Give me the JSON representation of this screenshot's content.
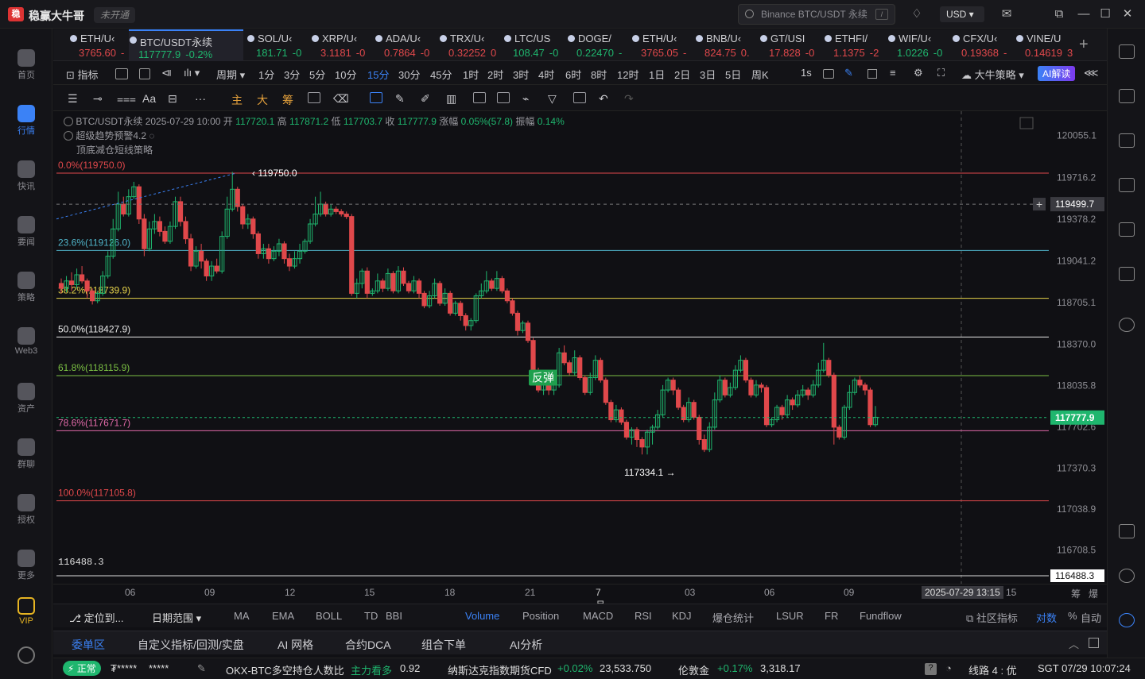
{
  "app": {
    "name": "稳赢大牛哥",
    "account_status": "未开通",
    "logo_char": "稳"
  },
  "search": {
    "placeholder": "Binance BTC/USDT 永续",
    "key": "/"
  },
  "currency": "USD",
  "nav": [
    {
      "label": "首页",
      "icon": "home-icon"
    },
    {
      "label": "行情",
      "icon": "chart-bars-icon",
      "active": true
    },
    {
      "label": "快讯",
      "icon": "news-icon"
    },
    {
      "label": "要闻",
      "icon": "doc-icon"
    },
    {
      "label": "策略",
      "icon": "robot-icon"
    },
    {
      "label": "Web3",
      "icon": "web3-icon"
    },
    {
      "label": "资产",
      "icon": "wallet-icon"
    },
    {
      "label": "群聊",
      "icon": "chat-icon"
    },
    {
      "label": "授权",
      "icon": "key-icon"
    },
    {
      "label": "更多",
      "icon": "grid-icon"
    },
    {
      "label": "VIP",
      "icon": "vip-icon"
    }
  ],
  "symbols": [
    {
      "name": "ETH/U‹",
      "price": "3765.60",
      "chg": "-",
      "color": "#e0484b"
    },
    {
      "name": "BTC/USDT永续",
      "price": "117777.9",
      "chg": "-0.2%",
      "color": "#1fb66e",
      "active": true
    },
    {
      "name": "SOL/U‹",
      "price": "181.71",
      "chg": "-0",
      "color": "#1fb66e"
    },
    {
      "name": "XRP/U‹",
      "price": "3.1181",
      "chg": "-0",
      "color": "#e0484b"
    },
    {
      "name": "ADA/U‹",
      "price": "0.7864",
      "chg": "-0",
      "color": "#e0484b"
    },
    {
      "name": "TRX/U‹",
      "price": "0.32252",
      "chg": "0",
      "color": "#e0484b"
    },
    {
      "name": "LTC/US",
      "price": "108.47",
      "chg": "-0",
      "color": "#1fb66e"
    },
    {
      "name": "DOGE/",
      "price": "0.22470",
      "chg": "-",
      "color": "#1fb66e"
    },
    {
      "name": "ETH/U‹",
      "price": "3765.05",
      "chg": "-",
      "color": "#e0484b"
    },
    {
      "name": "BNB/U‹",
      "price": "824.75",
      "chg": "0.",
      "color": "#e0484b"
    },
    {
      "name": "GT/USI",
      "price": "17.828",
      "chg": "-0",
      "color": "#e0484b"
    },
    {
      "name": "ETHFI/",
      "price": "1.1375",
      "chg": "-2",
      "color": "#e0484b"
    },
    {
      "name": "WIF/U‹",
      "price": "1.0226",
      "chg": "-0",
      "color": "#1fb66e"
    },
    {
      "name": "CFX/U‹",
      "price": "0.19368",
      "chg": "-",
      "color": "#e0484b"
    },
    {
      "name": "VINE/U",
      "price": "0.14619",
      "chg": "3",
      "color": "#e0484b"
    }
  ],
  "intervals": {
    "indicator": "指标",
    "period": "周期",
    "items": [
      "1分",
      "3分",
      "5分",
      "10分",
      "15分",
      "30分",
      "45分",
      "1时",
      "2时",
      "3时",
      "4时",
      "6时",
      "8时",
      "12时",
      "1日",
      "2日",
      "3日",
      "5日",
      "周K"
    ],
    "active": "15分",
    "seconds": "1s",
    "strategy": "大牛策略",
    "ai": "AI解读"
  },
  "drawtools": {
    "text_tools": [
      "主",
      "大",
      "筹"
    ],
    "font_tool": "Aa"
  },
  "legend": {
    "symbol": "BTC/USDT永续",
    "time": "2025-07-29 10:00",
    "open_label": "开",
    "open": "117720.1",
    "high_label": "高",
    "high": "117871.2",
    "low_label": "低",
    "low": "117703.7",
    "close_label": "收",
    "close": "117777.9",
    "chg_label": "涨幅",
    "chg": "0.05%(57.8)",
    "amp_label": "振幅",
    "amp": "0.14%",
    "line2": "超级趋势预警4.2",
    "line3": "顶底减仓短线策略"
  },
  "chart_data": {
    "type": "candlestick",
    "y_ticks": [
      120055.1,
      119716.2,
      119378.2,
      119041.2,
      118705.1,
      118370.0,
      118035.8,
      117702.6,
      117370.3,
      117038.9,
      116708.5
    ],
    "ylim": [
      116488.3,
      120250
    ],
    "x_ticks": [
      "06",
      "09",
      "12",
      "15",
      "18",
      "21",
      "7月29",
      "03",
      "06",
      "09",
      "15"
    ],
    "crosshair_price": "119499.7",
    "crosshair_time": "2025-07-29 13:15",
    "last_price": "117777.9",
    "min_price_label": "116488.3",
    "fib_levels": [
      {
        "label": "0.0%(119750.0)",
        "price": 119750.0,
        "color": "#e0484b"
      },
      {
        "label": "23.6%(119126.0)",
        "price": 119126.0,
        "color": "#4fb3c8"
      },
      {
        "label": "38.2%(118739.9)",
        "price": 118739.9,
        "color": "#e6d34a"
      },
      {
        "label": "50.0%(118427.9)",
        "price": 118427.9,
        "color": "#e8e8e8"
      },
      {
        "label": "61.8%(118115.9)",
        "price": 118115.9,
        "color": "#7bc043"
      },
      {
        "label": "78.6%(117671.7)",
        "price": 117671.7,
        "color": "#e06aa8"
      },
      {
        "label": "100.0%(117105.8)",
        "price": 117105.8,
        "color": "#e0484b"
      }
    ],
    "annotations": [
      {
        "text": "119750.0",
        "price": 119750.0
      },
      {
        "text": "117334.1",
        "price": 117334.1
      },
      {
        "text": "反弹",
        "price": 118100
      }
    ],
    "candles": [
      [
        118860,
        118820,
        118900,
        118780
      ],
      [
        118820,
        118880,
        118920,
        118790
      ],
      [
        118880,
        118850,
        118950,
        118800
      ],
      [
        118850,
        118930,
        118980,
        118820
      ],
      [
        118930,
        118880,
        119000,
        118860
      ],
      [
        118880,
        118800,
        118900,
        118740
      ],
      [
        118800,
        118720,
        118820,
        118690
      ],
      [
        118720,
        118780,
        118800,
        118700
      ],
      [
        118780,
        118920,
        118960,
        118760
      ],
      [
        118920,
        119080,
        119120,
        118900
      ],
      [
        119080,
        119300,
        119380,
        119060
      ],
      [
        119300,
        119500,
        119600,
        119280
      ],
      [
        119500,
        119420,
        119560,
        119400
      ],
      [
        119420,
        119560,
        119620,
        119400
      ],
      [
        119560,
        119640,
        119680,
        119540
      ],
      [
        119640,
        119380,
        119660,
        119340
      ],
      [
        119380,
        119140,
        119420,
        119080
      ],
      [
        119140,
        119300,
        119360,
        119120
      ],
      [
        119300,
        119360,
        119420,
        119260
      ],
      [
        119360,
        119280,
        119400,
        119240
      ],
      [
        119280,
        119200,
        119320,
        119180
      ],
      [
        119200,
        119320,
        119360,
        119180
      ],
      [
        119320,
        119520,
        119560,
        119300
      ],
      [
        119520,
        119360,
        119560,
        119320
      ],
      [
        119360,
        119220,
        119400,
        119180
      ],
      [
        119220,
        119000,
        119260,
        118960
      ],
      [
        119000,
        119120,
        119160,
        118980
      ],
      [
        119120,
        119040,
        119180,
        118980
      ],
      [
        119040,
        118920,
        119060,
        118880
      ],
      [
        118920,
        119000,
        119040,
        118880
      ],
      [
        119000,
        118960,
        119060,
        118940
      ],
      [
        118960,
        119240,
        119280,
        118940
      ],
      [
        119240,
        119460,
        119560,
        119220
      ],
      [
        119460,
        119620,
        119760,
        119440
      ],
      [
        119620,
        119480,
        119640,
        119440
      ],
      [
        119480,
        119340,
        119500,
        119300
      ],
      [
        119340,
        119380,
        119420,
        119300
      ],
      [
        119380,
        119260,
        119400,
        119220
      ],
      [
        119260,
        119100,
        119280,
        119060
      ],
      [
        119100,
        119140,
        119180,
        119060
      ],
      [
        119140,
        119060,
        119180,
        119020
      ],
      [
        119060,
        119120,
        119160,
        119040
      ],
      [
        119120,
        119180,
        119220,
        119080
      ],
      [
        119180,
        119060,
        119200,
        119020
      ],
      [
        119060,
        119000,
        119100,
        118960
      ],
      [
        119000,
        119060,
        119120,
        118980
      ],
      [
        119060,
        119120,
        119180,
        119020
      ],
      [
        119120,
        119200,
        119220,
        119100
      ],
      [
        119200,
        119340,
        119380,
        119180
      ],
      [
        119340,
        119420,
        119560,
        119320
      ],
      [
        119420,
        119500,
        119600,
        119400
      ],
      [
        119500,
        119420,
        119520,
        119400
      ],
      [
        119420,
        119460,
        119500,
        119400
      ],
      [
        119460,
        119440,
        119480,
        119420
      ],
      [
        119440,
        119420,
        119460,
        119400
      ],
      [
        119420,
        119400,
        119440,
        119380
      ],
      [
        119400,
        118780,
        119420,
        118760
      ],
      [
        118780,
        118860,
        118900,
        118740
      ],
      [
        118860,
        118960,
        118980,
        118820
      ],
      [
        118960,
        118780,
        118990,
        118740
      ],
      [
        118780,
        118800,
        118820,
        118760
      ],
      [
        118800,
        118880,
        118940,
        118780
      ],
      [
        118880,
        118820,
        118900,
        118790
      ],
      [
        118820,
        118940,
        118980,
        118800
      ],
      [
        118940,
        118800,
        118960,
        118780
      ],
      [
        118800,
        118960,
        119000,
        118780
      ],
      [
        118960,
        118860,
        118990,
        118840
      ],
      [
        118860,
        118800,
        118880,
        118780
      ],
      [
        118800,
        118880,
        118920,
        118780
      ],
      [
        118880,
        118780,
        118900,
        118740
      ],
      [
        118780,
        118680,
        118800,
        118660
      ],
      [
        118680,
        118760,
        118800,
        118660
      ],
      [
        118760,
        118860,
        118900,
        118740
      ],
      [
        118860,
        118700,
        118880,
        118680
      ],
      [
        118700,
        118780,
        118820,
        118680
      ],
      [
        118780,
        118620,
        118800,
        118600
      ],
      [
        118620,
        118700,
        118720,
        118600
      ],
      [
        118700,
        118600,
        118720,
        118560
      ],
      [
        118600,
        118520,
        118620,
        118480
      ],
      [
        118520,
        118560,
        118580,
        118480
      ],
      [
        118560,
        118760,
        118780,
        118540
      ],
      [
        118760,
        118800,
        118860,
        118740
      ],
      [
        118800,
        118880,
        118960,
        118780
      ],
      [
        118880,
        118820,
        118900,
        118800
      ],
      [
        118820,
        118900,
        118960,
        118800
      ],
      [
        118900,
        118800,
        118920,
        118780
      ],
      [
        118800,
        118720,
        118820,
        118700
      ],
      [
        118720,
        118620,
        118740,
        118600
      ],
      [
        118620,
        118480,
        118640,
        118440
      ],
      [
        118480,
        118540,
        118560,
        118460
      ],
      [
        118540,
        118400,
        118560,
        118380
      ],
      [
        118400,
        118160,
        118420,
        118140
      ],
      [
        118160,
        118000,
        118180,
        117980
      ],
      [
        118000,
        118120,
        118160,
        117960
      ],
      [
        118120,
        118000,
        118140,
        117960
      ],
      [
        118000,
        118040,
        118080,
        117960
      ],
      [
        118040,
        118300,
        118340,
        118020
      ],
      [
        118300,
        118220,
        118360,
        118200
      ],
      [
        118220,
        118140,
        118240,
        118120
      ],
      [
        118140,
        118260,
        118320,
        118120
      ],
      [
        118260,
        118100,
        118280,
        118080
      ],
      [
        118100,
        117980,
        118120,
        117960
      ],
      [
        117980,
        118100,
        118140,
        117960
      ],
      [
        118100,
        118240,
        118280,
        118080
      ],
      [
        118240,
        118080,
        118260,
        118060
      ],
      [
        118080,
        117900,
        118100,
        117880
      ],
      [
        117900,
        117760,
        117920,
        117740
      ],
      [
        117760,
        117840,
        117880,
        117740
      ],
      [
        117840,
        117740,
        117860,
        117720
      ],
      [
        117740,
        117620,
        117760,
        117600
      ],
      [
        117620,
        117680,
        117700,
        117560
      ],
      [
        117680,
        117600,
        117700,
        117540
      ],
      [
        117600,
        117540,
        117620,
        117480
      ],
      [
        117540,
        117660,
        117680,
        117480
      ],
      [
        117660,
        117700,
        117720,
        117560
      ],
      [
        117700,
        117800,
        117840,
        117680
      ],
      [
        117800,
        118000,
        118040,
        117780
      ],
      [
        118000,
        118080,
        118100,
        117980
      ],
      [
        118080,
        118000,
        118100,
        117960
      ],
      [
        118000,
        117860,
        118020,
        117840
      ],
      [
        117860,
        117760,
        117880,
        117740
      ],
      [
        117760,
        117900,
        117940,
        117740
      ],
      [
        117900,
        117780,
        117920,
        117760
      ],
      [
        117780,
        117600,
        117800,
        117560
      ],
      [
        117600,
        117520,
        117640,
        117500
      ],
      [
        117520,
        117700,
        117740,
        117500
      ],
      [
        117700,
        117920,
        117980,
        117680
      ],
      [
        117920,
        118080,
        118120,
        117900
      ],
      [
        118080,
        117960,
        118100,
        117940
      ],
      [
        117960,
        118020,
        118060,
        117940
      ],
      [
        118020,
        118160,
        118200,
        118000
      ],
      [
        118160,
        118240,
        118280,
        118140
      ],
      [
        118240,
        118080,
        118260,
        118060
      ],
      [
        118080,
        117960,
        118100,
        117940
      ],
      [
        117960,
        118040,
        118080,
        117940
      ],
      [
        118040,
        118020,
        118060,
        117980
      ],
      [
        118020,
        117720,
        118040,
        117700
      ],
      [
        117720,
        117760,
        117780,
        117700
      ],
      [
        117760,
        117860,
        117880,
        117740
      ],
      [
        117860,
        117800,
        117880,
        117760
      ],
      [
        117800,
        117920,
        117960,
        117780
      ],
      [
        117920,
        117880,
        117940,
        117840
      ],
      [
        117880,
        117960,
        118000,
        117860
      ],
      [
        117960,
        118000,
        118040,
        117940
      ],
      [
        118000,
        117960,
        118020,
        117920
      ],
      [
        117960,
        118040,
        118080,
        117940
      ],
      [
        118040,
        118160,
        118220,
        118020
      ],
      [
        118160,
        118240,
        118380,
        118140
      ],
      [
        118240,
        118120,
        118260,
        118100
      ],
      [
        118120,
        117700,
        118140,
        117560
      ],
      [
        117700,
        117620,
        117720,
        117600
      ],
      [
        117620,
        117860,
        117880,
        117600
      ],
      [
        117860,
        117980,
        118040,
        117840
      ],
      [
        117980,
        118080,
        118100,
        117960
      ],
      [
        118080,
        118040,
        118120,
        118020
      ],
      [
        118040,
        118000,
        118060,
        117960
      ],
      [
        118000,
        117720,
        118020,
        117700
      ],
      [
        117720,
        117780,
        117871,
        117703
      ]
    ]
  },
  "axis_labels": [
    "06",
    "09",
    "12",
    "15",
    "18",
    "21",
    "7月29",
    "03",
    "06",
    "09",
    "15"
  ],
  "axis_right": {
    "label1": "筹",
    "label2": "爆"
  },
  "indicator_bar": {
    "locate": "定位到...",
    "range": "日期范围",
    "items": [
      "MA",
      "EMA",
      "BOLL",
      "TD",
      "BBI",
      "Volume",
      "Position",
      "MACD",
      "RSI",
      "KDJ",
      "爆仓统计",
      "LSUR",
      "FR",
      "Fundflow"
    ],
    "active": "Volume",
    "community": "社区指标",
    "log": "对数",
    "pct": "%",
    "auto": "自动"
  },
  "panel_tabs": [
    "委单区",
    "自定义指标/回测/实盘",
    "AI 网格",
    "合约DCA",
    "组合下单",
    "AI分析"
  ],
  "status": {
    "mode": "正常",
    "mask1": "₮*****",
    "mask2": "*****",
    "ticker1": "OKX-BTC多空持仓人数比",
    "ticker1_tag": "主力看多",
    "ticker1_val": "0.92",
    "ticker2": "纳斯达克指数期货CFD",
    "ticker2_chg": "+0.02%",
    "ticker2_val": "23,533.750",
    "ticker3": "伦敦金",
    "ticker3_chg": "+0.17%",
    "ticker3_val": "3,318.17",
    "line": "线路 4 : 优",
    "clock": "SGT 07/29 10:07:24"
  },
  "colors": {
    "up": "#1fb66e",
    "down": "#e0484b",
    "accent": "#3b82f6"
  }
}
